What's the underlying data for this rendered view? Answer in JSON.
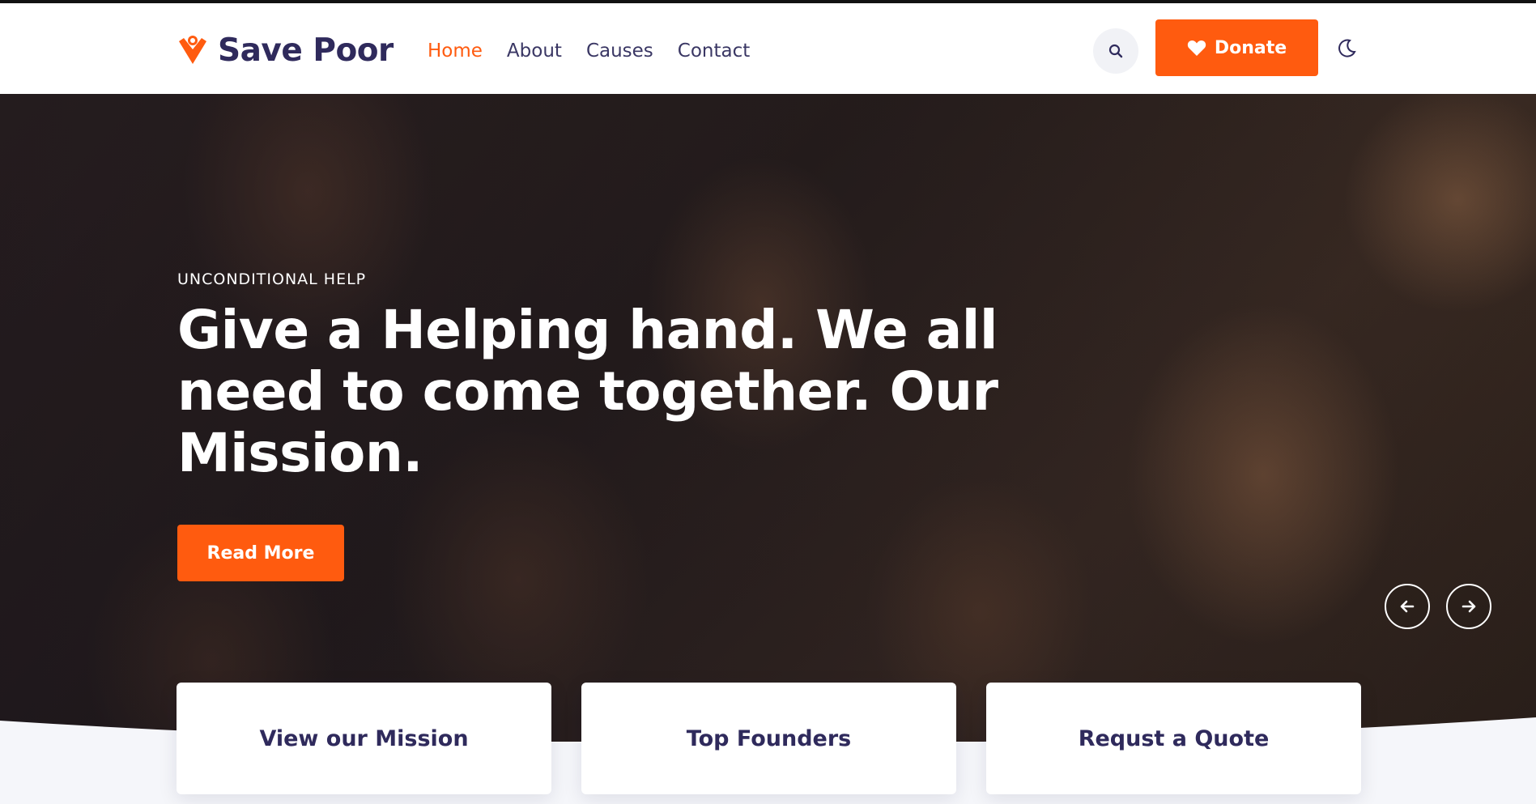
{
  "brand": {
    "name": "Save Poor",
    "logo_icon": "heart-person-icon"
  },
  "nav": {
    "items": [
      {
        "label": "Home",
        "active": true
      },
      {
        "label": "About",
        "active": false
      },
      {
        "label": "Causes",
        "active": false
      },
      {
        "label": "Contact",
        "active": false
      }
    ]
  },
  "header": {
    "search_icon": "search-icon",
    "donate_label": "Donate",
    "donate_icon": "heart-icon",
    "theme_icon": "moon-icon"
  },
  "hero": {
    "eyebrow": "UNCONDITIONAL HELP",
    "headline": "Give a Helping hand. We all need to come together. Our Mission.",
    "cta_label": "Read More",
    "prev_icon": "arrow-left-icon",
    "next_icon": "arrow-right-icon"
  },
  "cards": [
    {
      "label": "View our Mission"
    },
    {
      "label": "Top Founders"
    },
    {
      "label": "Requst a Quote"
    }
  ],
  "colors": {
    "accent": "#ff5b0f",
    "text_dark": "#2f2a5c",
    "background": "#ffffff",
    "section_bg": "#f5f6fa"
  }
}
